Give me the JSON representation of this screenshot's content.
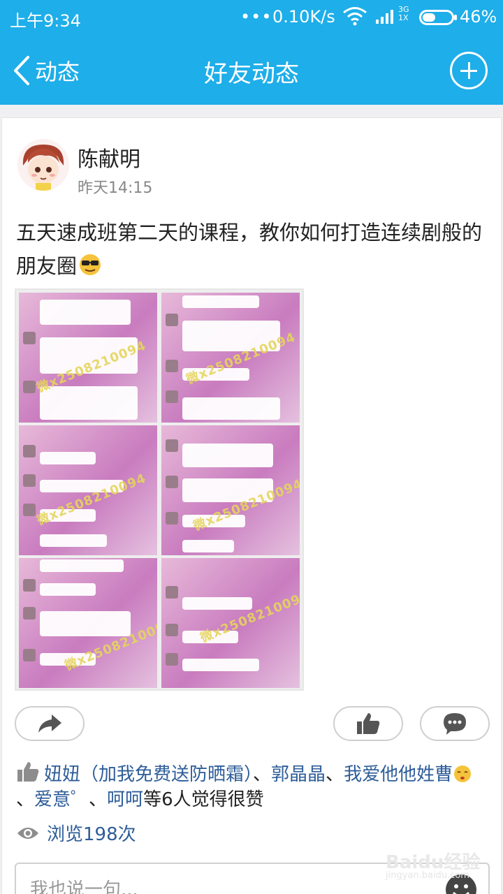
{
  "status_bar": {
    "time": "上午9:34",
    "dots": "•••",
    "speed": "0.10K/s",
    "network_top": "3G",
    "network_bottom": "1X",
    "battery": "46%",
    "battery_level": 0.46
  },
  "nav": {
    "back_label": "动态",
    "title": "好友动态"
  },
  "post": {
    "author": "陈献明",
    "time": "昨天14:15",
    "text": "五天速成班第二天的课程，教你如何打造连续剧般的朋友圈",
    "image_watermark": "微x2508210094"
  },
  "likes": {
    "names": [
      "妞妞（加我免费送防晒霜）",
      "郭晶晶",
      "我爱他他姓曹",
      "爱意゜",
      "呵呵"
    ],
    "sep": "、",
    "suffix": "等6人觉得很赞"
  },
  "views": {
    "label": "浏览198次"
  },
  "comment": {
    "placeholder": "我也说一句..."
  },
  "watermark": {
    "brand": "Baidu经验",
    "url": "jingyan.baidu.com"
  },
  "colors": {
    "header": "#1eaee9",
    "link": "#2e5d99"
  }
}
